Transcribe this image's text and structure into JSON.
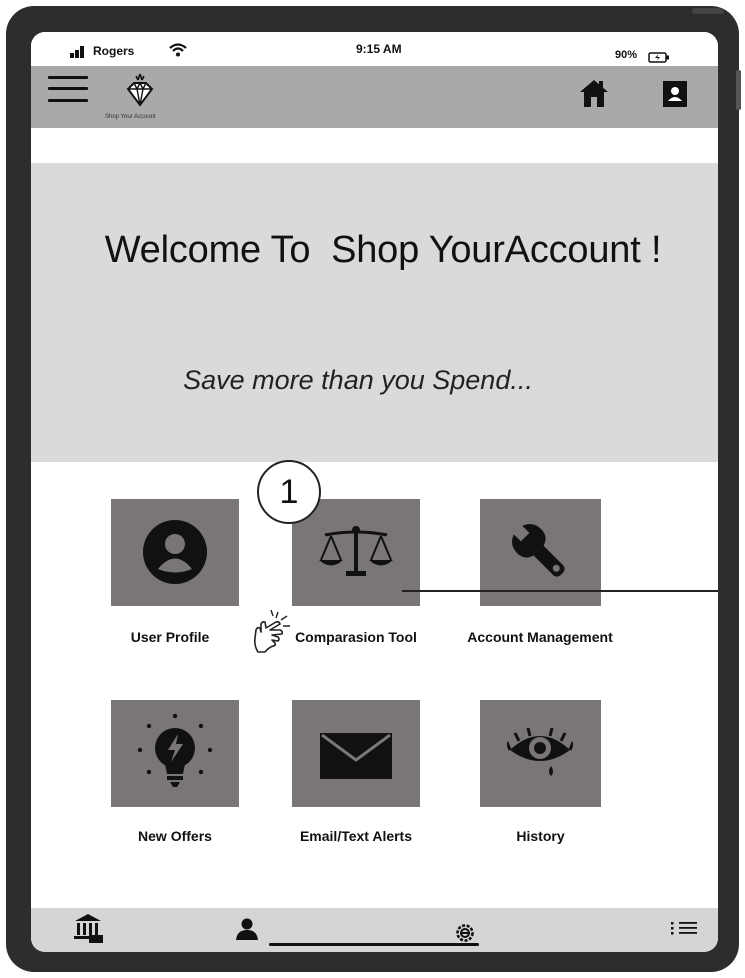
{
  "status_bar": {
    "carrier": "Rogers",
    "time": "9:15 AM",
    "battery_percent": "90%"
  },
  "header": {
    "logo_caption": "Shop Your Account",
    "icons": [
      "menu-icon",
      "diamond-logo-icon",
      "home-icon",
      "contact-card-icon"
    ]
  },
  "banner": {
    "title": "Welcome To  Shop YourAccount !",
    "tagline": "Save more than you Spend..."
  },
  "tiles": [
    {
      "label": "User Profile",
      "icon": "user-profile-icon"
    },
    {
      "label": "Comparasion Tool",
      "icon": "balance-scale-icon"
    },
    {
      "label": "Account Management",
      "icon": "wrench-icon"
    },
    {
      "label": "New Offers",
      "icon": "lightbulb-icon"
    },
    {
      "label": "Email/Text Alerts",
      "icon": "envelope-icon"
    },
    {
      "label": "History",
      "icon": "eye-icon"
    }
  ],
  "annotation": {
    "step_number": "1",
    "pointer_icon": "tap-hand-icon"
  },
  "bottom_nav": {
    "icons": [
      "bank-icon",
      "person-icon",
      "settings-icon",
      "list-icon"
    ]
  },
  "colors": {
    "header_bg": "#a9a9a9",
    "banner_bg": "#dadada",
    "tile_bg": "#7a7676",
    "bottom_nav_bg": "#d5d5d5",
    "device_frame": "#2d2d2d"
  }
}
